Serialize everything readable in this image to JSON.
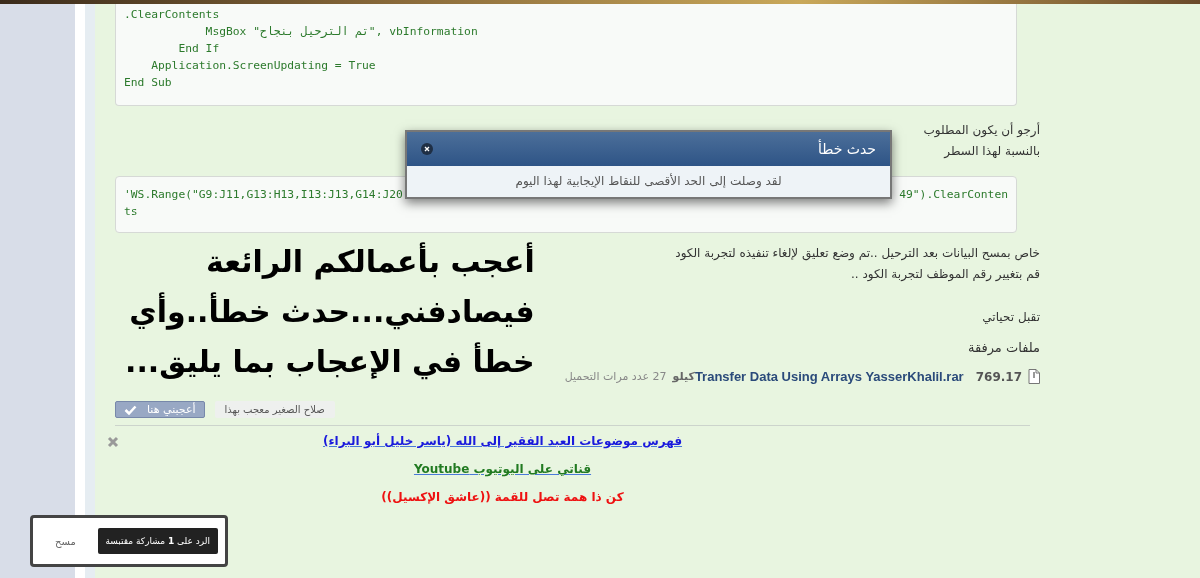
{
  "code_block_1": {
    "lines": [
      ".ClearContents",
      "            MsgBox \"تم الترحيل بنجاح\", vbInformation",
      "        End If",
      "    Application.ScreenUpdating = True",
      "End Sub"
    ]
  },
  "paragraph_1": [
    "أرجو أن يكون المطلوب",
    "بالنسبة لهذا السطر"
  ],
  "code_block_2": {
    "visible_start": "'WS.Range(\"G9:J11,G13:H13,I13:J13,G14:J20",
    "visible_end": "49\").ClearConten",
    "continuation": "ts"
  },
  "paragraph_2": [
    "خاص بمسح البيانات بعد الترحيل ..تم وضع تعليق لإلغاء تنفيذه لتجربة الكود",
    "قم بتغيير رقم الموظف لتجربة الكود .."
  ],
  "closing": "تقبل تحياتي",
  "attachments": {
    "heading": "ملفات مرفقة",
    "files": [
      {
        "size": "769.17",
        "name": "Transfer Data Using Arrays YasserKhalil.rar",
        "unit": "كيلو",
        "downloads": "27 عدد مرات التحميل"
      }
    ]
  },
  "big_text": [
    "أعجب بأعمالكم الرائعة",
    "فيصادفني...حدث خطأ..وأي",
    "خطأ في الإعجاب بما يليق..."
  ],
  "like": {
    "button": "أعجبني هنا",
    "likers": "صلاح الصغير معجب بهذا"
  },
  "signature": [
    {
      "text": "فهرس موضوعات العبد الفقير إلى الله (ياسر خليل أبو البراء)",
      "color": "#1a1adc",
      "link": true
    },
    {
      "text": "قناتي على اليوتيوب Youtube",
      "color": "#217a21",
      "link": true
    },
    {
      "text": "كن ذا همة تصل للقمة ((عاشق الإكسيل))",
      "color": "#ee1111",
      "link": false
    }
  ],
  "dialog": {
    "title": "حدث خطأ",
    "message": "لقد وصلت إلى الحد الأقصى للنقاط الإيجابية لهذا اليوم"
  },
  "quote_popup": {
    "clear": "مسح",
    "reply_button": "الرد على **1** مشاركة مقتبسة"
  }
}
